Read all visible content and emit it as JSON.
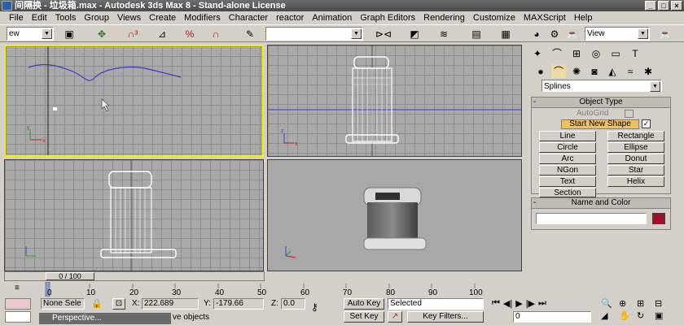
{
  "window": {
    "title": "间隔换 - 垃圾箱.max - Autodesk 3ds Max 8 - Stand-alone License",
    "controls": [
      "_",
      "□",
      "×"
    ]
  },
  "menu": {
    "items": [
      "File",
      "Edit",
      "Tools",
      "Group",
      "Views",
      "Create",
      "Modifiers",
      "Character",
      "reactor",
      "Animation",
      "Graph Editors",
      "Rendering",
      "Customize",
      "MAXScript",
      "Help"
    ]
  },
  "toolbar": {
    "selection_filter": "ew",
    "named_selection": "",
    "view_combo": "View"
  },
  "viewports": {
    "top_left_label": "",
    "axis_x": "x",
    "axis_y": "y",
    "axis_z": "z"
  },
  "command_panel": {
    "category_dropdown": "Splines",
    "object_type": {
      "title": "Object Type",
      "autogrid": "AutoGrid",
      "start_new_shape": "Start New Shape",
      "buttons": [
        "Line",
        "Rectangle",
        "Circle",
        "Ellipse",
        "Arc",
        "Donut",
        "NGon",
        "Star",
        "Text",
        "Helix",
        "Section"
      ]
    },
    "name_and_color": {
      "title": "Name and Color",
      "name_value": "",
      "color": "#a0102a"
    }
  },
  "timeline": {
    "frame_counter": "0 / 100",
    "ticks": [
      "0",
      "10",
      "20",
      "30",
      "40",
      "50",
      "60",
      "70",
      "80",
      "90",
      "100"
    ]
  },
  "status": {
    "selection": "None Sele",
    "x_label": "X:",
    "x_value": "222.689",
    "y_label": "Y:",
    "y_value": "-179.66",
    "z_label": "Z:",
    "z_value": "0.0",
    "auto_key": "Auto Key",
    "key_mode": "Selected",
    "set_key": "Set Key",
    "key_filters": "Key Filters...",
    "frame_value": "0",
    "prompt": "ve objects",
    "taskbar_item": "Perspective..."
  }
}
